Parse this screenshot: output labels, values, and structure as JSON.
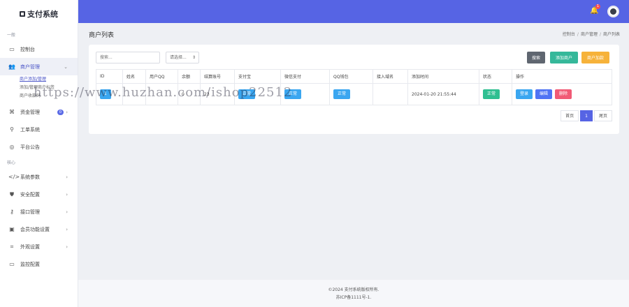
{
  "brand": {
    "title": "支付系统",
    "icon": "payment-logo-icon"
  },
  "sidebar": {
    "section_general": "一般",
    "section_core": "核心",
    "items": [
      {
        "label": "控制台",
        "icon": "monitor-icon"
      },
      {
        "label": "商户管理",
        "icon": "users-icon"
      },
      {
        "label": "资金管理",
        "icon": "fund-icon",
        "badge": "0"
      },
      {
        "label": "工单系统",
        "icon": "ticket-icon"
      },
      {
        "label": "平台公告",
        "icon": "broadcast-icon"
      },
      {
        "label": "系统参数",
        "icon": "code-icon"
      },
      {
        "label": "安全配置",
        "icon": "shield-icon"
      },
      {
        "label": "接口管理",
        "icon": "key-icon"
      },
      {
        "label": "会员功能设置",
        "icon": "settings-box-icon"
      },
      {
        "label": "外观设置",
        "icon": "frame-icon"
      },
      {
        "label": "监控配置",
        "icon": "monitor-icon"
      }
    ],
    "sub_items": [
      "商户添加/管理",
      "添加/管理商户标签",
      "商户收款码"
    ]
  },
  "topbar": {
    "notification_count": "1"
  },
  "page": {
    "title": "商户列表",
    "breadcrumb": [
      "控制台",
      "商户管理",
      "商户列表"
    ]
  },
  "toolbar": {
    "search_placeholder": "搜索...",
    "select_value": "请选择...",
    "search_label": "搜索",
    "add_label": "添加商户",
    "fund_label": "商户加款"
  },
  "table": {
    "headers": [
      "ID",
      "姓名",
      "用户QQ",
      "余额",
      "结算账号",
      "支付宝",
      "微信支付",
      "QQ钱包",
      "接入域名",
      "添加时间",
      "状态",
      "操作"
    ],
    "rows": [
      {
        "id": "1",
        "name": "",
        "qq": "",
        "balance": "0",
        "account": "23",
        "alipay": "正常",
        "wxpay": "正常",
        "qqpay": "正常",
        "domain": "",
        "time": "2024-01-20 21:55:44",
        "status": "正常",
        "ops": [
          "登录",
          "编辑",
          "删除"
        ]
      }
    ]
  },
  "pager": {
    "first": "首页",
    "current": "1",
    "last": "尾页"
  },
  "footer": {
    "copyright": "©2024 支付系统版权所有.",
    "icp": "苏ICP备1111号-1."
  },
  "watermark": "https://www.huzhan.com/ishop22512",
  "colors": {
    "primary": "#5664e4",
    "success": "#35b89a",
    "warning": "#f6b23a",
    "danger": "#f15a75",
    "info": "#3aa6f0"
  }
}
